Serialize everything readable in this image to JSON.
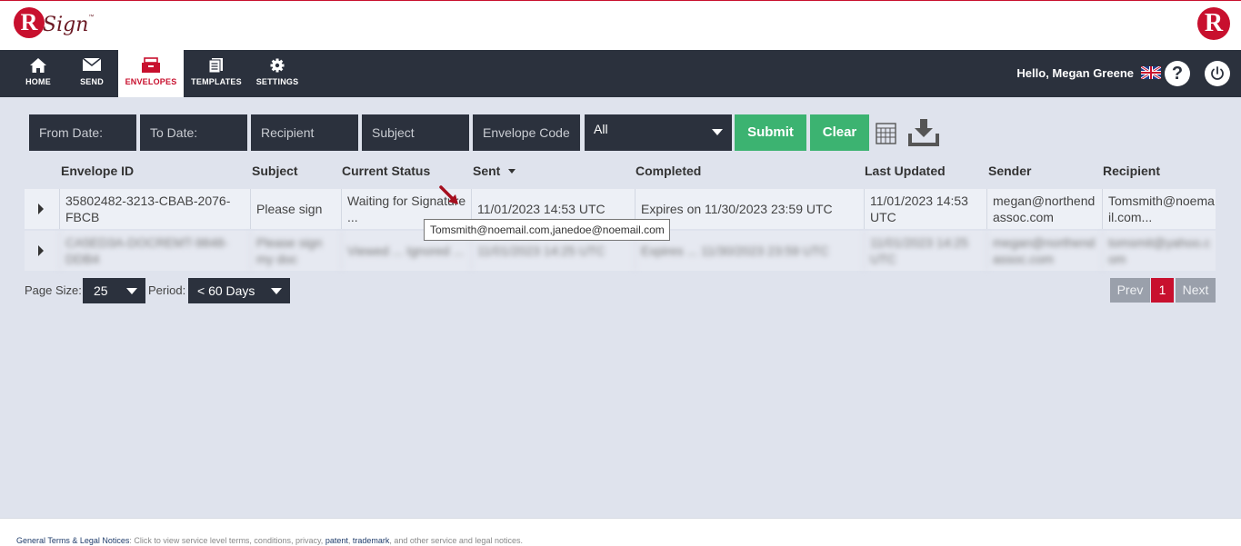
{
  "app": {
    "brand_letter": "R",
    "brand_word": "Sign",
    "tm": "™"
  },
  "nav": {
    "items": [
      {
        "label": "HOME",
        "icon": "home-icon"
      },
      {
        "label": "SEND",
        "icon": "envelope-icon"
      },
      {
        "label": "ENVELOPES",
        "icon": "inbox-icon",
        "active": true
      },
      {
        "label": "TEMPLATES",
        "icon": "document-icon"
      },
      {
        "label": "SETTINGS",
        "icon": "gear-icon"
      }
    ],
    "greeting": "Hello, Megan Greene",
    "help": "?"
  },
  "filters": {
    "from_date": "From Date:",
    "to_date": "To Date:",
    "recipient": "Recipient",
    "subject": "Subject",
    "envelope_code": "Envelope Code",
    "status": "All",
    "submit": "Submit",
    "clear": "Clear"
  },
  "table": {
    "headers": [
      "Envelope ID",
      "Subject",
      "Current Status",
      "Sent",
      "Completed",
      "Last Updated",
      "Sender",
      "Recipient"
    ],
    "rows": [
      {
        "envelope_id": "35802482-3213-CBAB-2076-FBCB",
        "subject": "Please sign",
        "status": "Waiting for Signature ...",
        "sent": "11/01/2023 14:53 UTC",
        "completed": "Expires on 11/30/2023 23:59 UTC",
        "last_updated": "11/01/2023 14:53 UTC",
        "sender": "megan@northendassoc.com",
        "recipient": "Tomsmith@noemail.com..."
      },
      {
        "envelope_id": "CA5ED3A-DOCREMT-9848-DDB4",
        "subject": "Please sign my doc",
        "status": "Viewed ... Ignored ...",
        "sent": "11/01/2023 14:25 UTC",
        "completed": "Expires ... 11/30/2023 23:59 UTC",
        "last_updated": "11/01/2023 14:25 UTC",
        "sender": "megan@northendassoc.com",
        "recipient": "tomsmit@yahoo.com"
      }
    ],
    "tooltip": "Tomsmith@noemail.com,janedoe@noemail.com"
  },
  "paging": {
    "page_size_label": "Page Size:",
    "page_size": "25",
    "period_label": "Period:",
    "period": "< 60 Days",
    "prev": "Prev",
    "current": "1",
    "next": "Next"
  },
  "footer": {
    "title": "General Terms & Legal Notices",
    "text1": ": Click to view service level terms, conditions, privacy, ",
    "patent": "patent",
    "sep": ", ",
    "trademark": "trademark",
    "text2": ", and other service and legal notices."
  },
  "colors": {
    "accent": "#c8102e",
    "nav_bg": "#2b313d",
    "green": "#3cb371",
    "page_bg": "#dfe3ed"
  }
}
